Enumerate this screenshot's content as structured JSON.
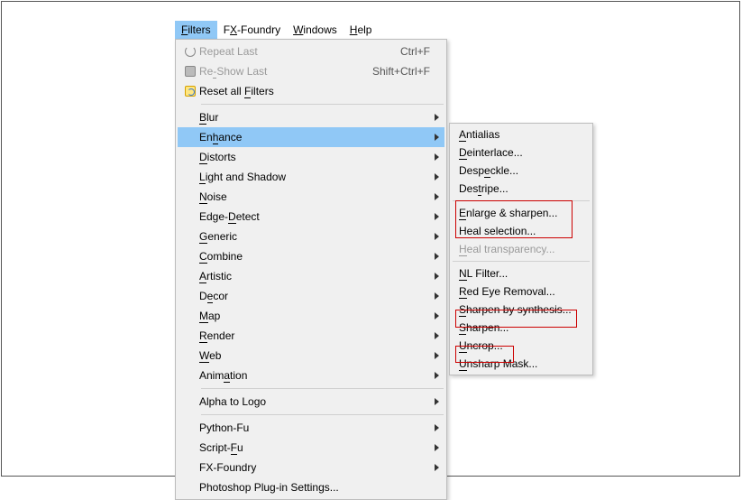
{
  "menubar": {
    "items": [
      {
        "label": "Filters",
        "u": 0,
        "active": true
      },
      {
        "label": "FX-Foundry",
        "u": 1
      },
      {
        "label": "Windows",
        "u": 0
      },
      {
        "label": "Help",
        "u": 0
      }
    ]
  },
  "filters_menu": {
    "groups": [
      [
        {
          "label": "Repeat Last",
          "u": -1,
          "accel": "Ctrl+F",
          "icon": "repeat-icon",
          "disabled": true
        },
        {
          "label": "Re-Show Last",
          "u": 2,
          "accel": "Shift+Ctrl+F",
          "icon": "reshow-icon",
          "disabled": true
        },
        {
          "label": "Reset all Filters",
          "u": 10,
          "icon": "reset-icon"
        }
      ],
      [
        {
          "label": "Blur",
          "u": 0,
          "submenu": true
        },
        {
          "label": "Enhance",
          "u": 2,
          "submenu": true,
          "highlight": true
        },
        {
          "label": "Distorts",
          "u": 0,
          "submenu": true
        },
        {
          "label": "Light and Shadow",
          "u": 0,
          "submenu": true
        },
        {
          "label": "Noise",
          "u": 0,
          "submenu": true
        },
        {
          "label": "Edge-Detect",
          "u": 5,
          "submenu": true
        },
        {
          "label": "Generic",
          "u": 0,
          "submenu": true
        },
        {
          "label": "Combine",
          "u": 0,
          "submenu": true
        },
        {
          "label": "Artistic",
          "u": 0,
          "submenu": true
        },
        {
          "label": "Decor",
          "u": 1,
          "submenu": true
        },
        {
          "label": "Map",
          "u": 0,
          "submenu": true
        },
        {
          "label": "Render",
          "u": 0,
          "submenu": true
        },
        {
          "label": "Web",
          "u": 0,
          "submenu": true
        },
        {
          "label": "Animation",
          "u": 4,
          "submenu": true
        }
      ],
      [
        {
          "label": "Alpha to Logo",
          "u": -1,
          "submenu": true
        }
      ],
      [
        {
          "label": "Python-Fu",
          "u": -1,
          "submenu": true
        },
        {
          "label": "Script-Fu",
          "u": 7,
          "submenu": true
        },
        {
          "label": "FX-Foundry",
          "u": -1,
          "submenu": true
        },
        {
          "label": "Photoshop Plug-in Settings...",
          "u": -1
        }
      ]
    ]
  },
  "enhance_menu": {
    "groups": [
      [
        {
          "label": "Antialias",
          "u": 0
        },
        {
          "label": "Deinterlace...",
          "u": 0
        },
        {
          "label": "Despeckle...",
          "u": 4
        },
        {
          "label": "Destripe...",
          "u": 3
        }
      ],
      [
        {
          "label": "Enlarge & sharpen...",
          "u": 0,
          "boxed": true
        },
        {
          "label": "Heal selection...",
          "u": 0,
          "boxed": true
        },
        {
          "label": "Heal transparency...",
          "u": 0,
          "disabled": true
        }
      ],
      [
        {
          "label": "NL Filter...",
          "u": 0
        },
        {
          "label": "Red Eye Removal...",
          "u": 0
        },
        {
          "label": "Sharpen by synthesis...",
          "u": 0,
          "boxed": true
        },
        {
          "label": "Sharpen...",
          "u": 0
        },
        {
          "label": "Uncrop...",
          "u": 0,
          "boxed": true
        },
        {
          "label": "Unsharp Mask...",
          "u": 0
        }
      ]
    ]
  }
}
